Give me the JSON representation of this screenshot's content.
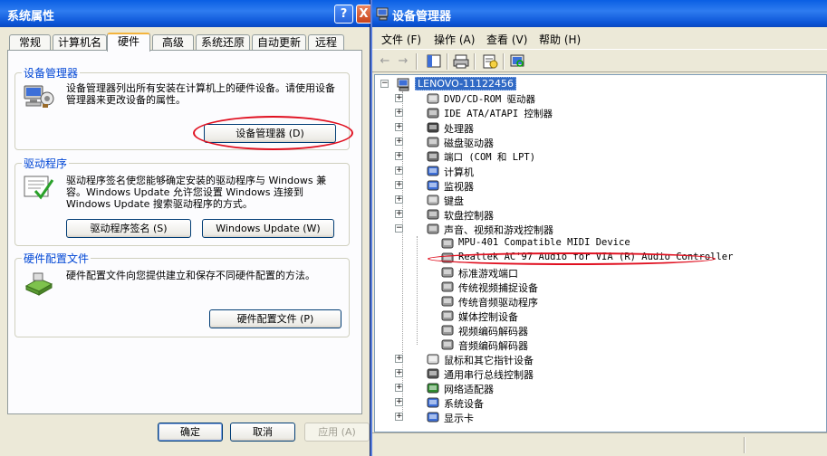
{
  "sysprops": {
    "title": "系统属性",
    "help_btn": "?",
    "close_btn": "X",
    "tabs": [
      "常规",
      "计算机名",
      "硬件",
      "高级",
      "系统还原",
      "自动更新",
      "远程"
    ],
    "device_manager": {
      "label": "设备管理器",
      "text": "设备管理器列出所有安装在计算机上的硬件设备。请使用设备管理器来更改设备的属性。",
      "button": "设备管理器 (D)"
    },
    "drivers": {
      "label": "驱动程序",
      "text": "驱动程序签名使您能够确定安装的驱动程序与 Windows 兼容。Windows Update 允许您设置 Windows 连接到 Windows Update 搜索驱动程序的方式。",
      "sign_button": "驱动程序签名 (S)",
      "update_button": "Windows Update (W)"
    },
    "profiles": {
      "label": "硬件配置文件",
      "text": "硬件配置文件向您提供建立和保存不同硬件配置的方法。",
      "button": "硬件配置文件 (P)"
    },
    "ok": "确定",
    "cancel": "取消",
    "apply": "应用 (A)"
  },
  "devmgr": {
    "title": "设备管理器",
    "menus": [
      "文件 (F)",
      "操作 (A)",
      "查看 (V)",
      "帮助 (H)"
    ],
    "root": "LENOVO-11122456",
    "categories": [
      {
        "label": "DVD/CD-ROM 驱动器",
        "icon": "cdrom-icon"
      },
      {
        "label": "IDE ATA/ATAPI 控制器",
        "icon": "ide-controller-icon"
      },
      {
        "label": "处理器",
        "icon": "processor-icon"
      },
      {
        "label": "磁盘驱动器",
        "icon": "disk-drive-icon"
      },
      {
        "label": "端口 (COM 和 LPT)",
        "icon": "port-icon"
      },
      {
        "label": "计算机",
        "icon": "computer-icon"
      },
      {
        "label": "监视器",
        "icon": "monitor-icon"
      },
      {
        "label": "键盘",
        "icon": "keyboard-icon"
      },
      {
        "label": "软盘控制器",
        "icon": "floppy-controller-icon"
      },
      {
        "label": "声音、视频和游戏控制器",
        "icon": "sound-icon"
      }
    ],
    "sound_children": [
      "MPU-401 Compatible MIDI Device",
      "Realtek AC'97 Audio for VIA (R) Audio Controller",
      "标准游戏端口",
      "传统视频捕捉设备",
      "传统音频驱动程序",
      "媒体控制设备",
      "视频编码解码器",
      "音频编码解码器"
    ],
    "categories_after": [
      {
        "label": "鼠标和其它指针设备",
        "icon": "mouse-icon"
      },
      {
        "label": "通用串行总线控制器",
        "icon": "usb-icon"
      },
      {
        "label": "网络适配器",
        "icon": "network-adapter-icon"
      },
      {
        "label": "系统设备",
        "icon": "system-devices-icon"
      },
      {
        "label": "显示卡",
        "icon": "display-adapter-icon"
      }
    ]
  }
}
